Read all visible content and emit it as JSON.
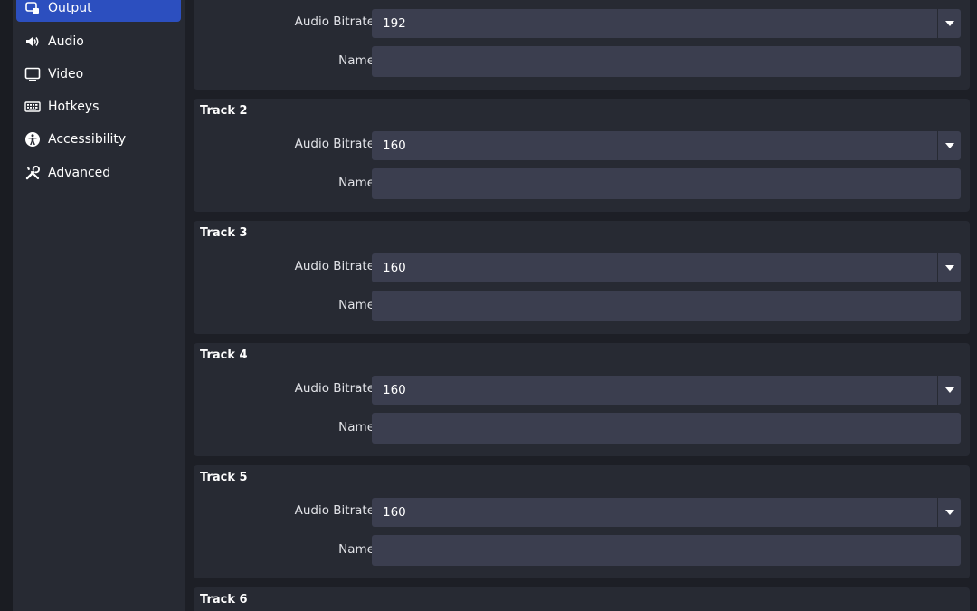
{
  "sidebar": {
    "items": [
      {
        "label": "Output",
        "icon": "output-icon",
        "active": true
      },
      {
        "label": "Audio",
        "icon": "speaker-icon",
        "active": false
      },
      {
        "label": "Video",
        "icon": "monitor-icon",
        "active": false
      },
      {
        "label": "Hotkeys",
        "icon": "keyboard-icon",
        "active": false
      },
      {
        "label": "Accessibility",
        "icon": "accessibility-icon",
        "active": false
      },
      {
        "label": "Advanced",
        "icon": "tools-icon",
        "active": false
      }
    ]
  },
  "tracks": {
    "track1": {
      "bitrate_label": "Audio Bitrate",
      "bitrate_value": "192",
      "name_label": "Name",
      "name_value": ""
    },
    "track2": {
      "title": "Track 2",
      "bitrate_label": "Audio Bitrate",
      "bitrate_value": "160",
      "name_label": "Name",
      "name_value": ""
    },
    "track3": {
      "title": "Track 3",
      "bitrate_label": "Audio Bitrate",
      "bitrate_value": "160",
      "name_label": "Name",
      "name_value": ""
    },
    "track4": {
      "title": "Track 4",
      "bitrate_label": "Audio Bitrate",
      "bitrate_value": "160",
      "name_label": "Name",
      "name_value": ""
    },
    "track5": {
      "title": "Track 5",
      "bitrate_label": "Audio Bitrate",
      "bitrate_value": "160",
      "name_label": "Name",
      "name_value": ""
    },
    "track6": {
      "title": "Track 6"
    }
  },
  "colors": {
    "accent": "#2c4fbf",
    "panel": "#272a33",
    "field": "#3b3e4f",
    "background": "#1d1f26"
  }
}
